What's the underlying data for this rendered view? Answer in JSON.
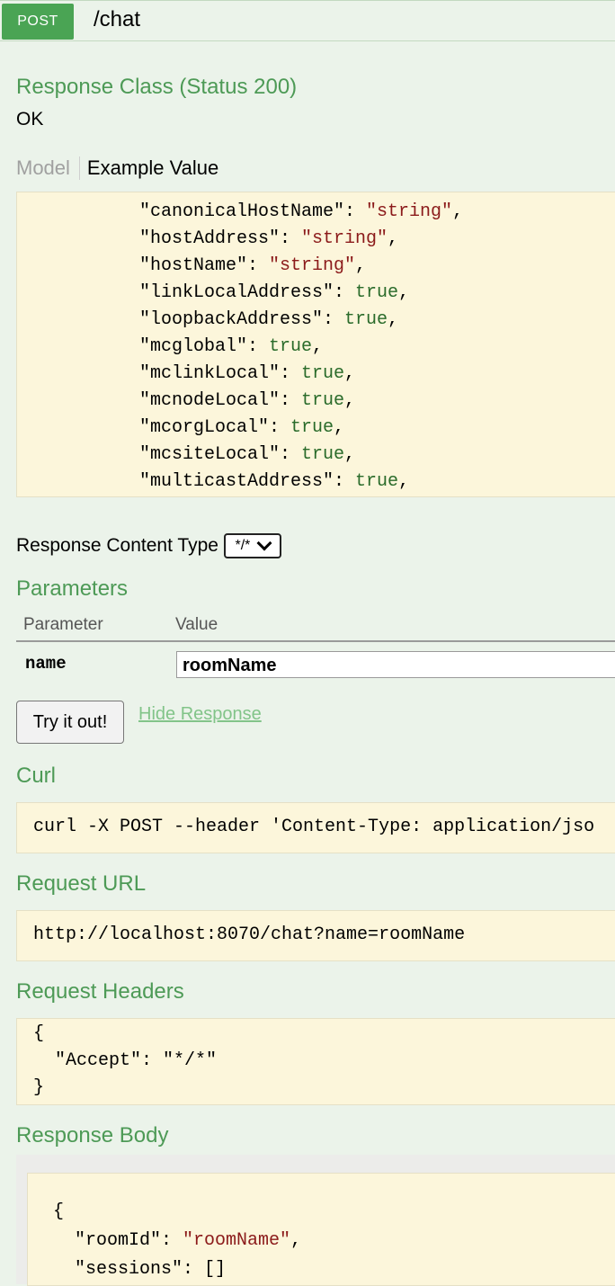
{
  "header": {
    "method": "POST",
    "path": "/chat"
  },
  "response_class": {
    "title": "Response Class (Status 200)",
    "status_text": "OK"
  },
  "tabs": {
    "model": "Model",
    "example": "Example Value"
  },
  "example_value": [
    [
      [
        "k",
        "\"canonicalHostName\": "
      ],
      [
        "s",
        "\"string\""
      ],
      [
        "k",
        ","
      ]
    ],
    [
      [
        "k",
        "\"hostAddress\": "
      ],
      [
        "s",
        "\"string\""
      ],
      [
        "k",
        ","
      ]
    ],
    [
      [
        "k",
        "\"hostName\": "
      ],
      [
        "s",
        "\"string\""
      ],
      [
        "k",
        ","
      ]
    ],
    [
      [
        "k",
        "\"linkLocalAddress\": "
      ],
      [
        "b",
        "true"
      ],
      [
        "k",
        ","
      ]
    ],
    [
      [
        "k",
        "\"loopbackAddress\": "
      ],
      [
        "b",
        "true"
      ],
      [
        "k",
        ","
      ]
    ],
    [
      [
        "k",
        "\"mcglobal\": "
      ],
      [
        "b",
        "true"
      ],
      [
        "k",
        ","
      ]
    ],
    [
      [
        "k",
        "\"mclinkLocal\": "
      ],
      [
        "b",
        "true"
      ],
      [
        "k",
        ","
      ]
    ],
    [
      [
        "k",
        "\"mcnodeLocal\": "
      ],
      [
        "b",
        "true"
      ],
      [
        "k",
        ","
      ]
    ],
    [
      [
        "k",
        "\"mcorgLocal\": "
      ],
      [
        "b",
        "true"
      ],
      [
        "k",
        ","
      ]
    ],
    [
      [
        "k",
        "\"mcsiteLocal\": "
      ],
      [
        "b",
        "true"
      ],
      [
        "k",
        ","
      ]
    ],
    [
      [
        "k",
        "\"multicastAddress\": "
      ],
      [
        "b",
        "true"
      ],
      [
        "k",
        ","
      ]
    ]
  ],
  "response_content_type": {
    "label": "Response Content Type",
    "selected": "*/*"
  },
  "parameters": {
    "title": "Parameters",
    "col_parameter": "Parameter",
    "col_value": "Value",
    "rows": [
      {
        "name": "name",
        "value": "roomName"
      }
    ]
  },
  "actions": {
    "try_label": "Try it out!",
    "hide_label": "Hide Response"
  },
  "curl": {
    "title": "Curl",
    "command": "curl -X POST --header 'Content-Type: application/jso"
  },
  "request_url": {
    "title": "Request URL",
    "value": "http://localhost:8070/chat?name=roomName"
  },
  "request_headers": {
    "title": "Request Headers",
    "lines": [
      "{",
      "  \"Accept\": \"*/*\"",
      "}"
    ]
  },
  "response_body": {
    "title": "Response Body",
    "lines": [
      [
        [
          "k",
          "{"
        ]
      ],
      [
        [
          "k",
          "  \"roomId\": "
        ],
        [
          "s",
          "\"roomName\""
        ],
        [
          "k",
          ","
        ]
      ],
      [
        [
          "k",
          "  \"sessions\": []"
        ]
      ]
    ]
  },
  "colors": {
    "section_title": "#4d9a56",
    "post_badge": "#4aa454",
    "code_background": "#fcf6db",
    "string_token": "#8b1a1a",
    "boolean_token": "#2a6b2a",
    "link": "#82c489"
  }
}
